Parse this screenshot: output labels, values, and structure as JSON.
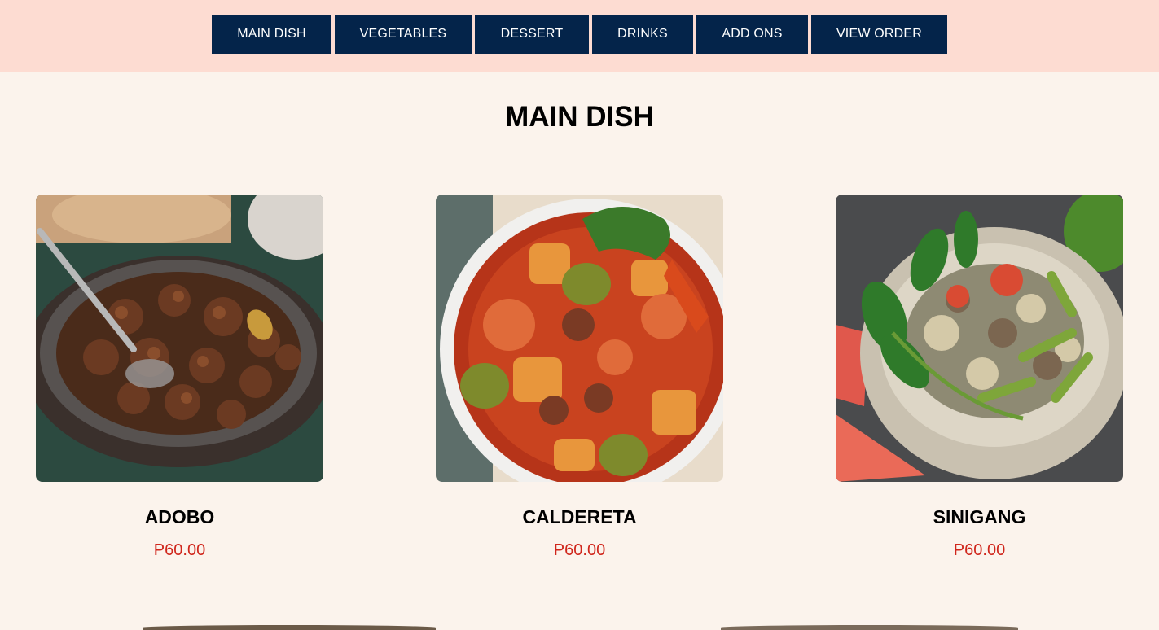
{
  "nav": {
    "items": [
      {
        "label": "MAIN DISH"
      },
      {
        "label": "VEGETABLES"
      },
      {
        "label": "DESSERT"
      },
      {
        "label": "DRINKS"
      },
      {
        "label": "ADD ONS"
      },
      {
        "label": "VIEW ORDER"
      }
    ]
  },
  "section": {
    "title": "MAIN DISH"
  },
  "products": [
    {
      "name": "ADOBO",
      "price": "P60.00"
    },
    {
      "name": "CALDERETA",
      "price": "P60.00"
    },
    {
      "name": "SINIGANG",
      "price": "P60.00"
    }
  ],
  "colors": {
    "header_bg": "#fddcd2",
    "nav_button": "#04244a",
    "page_bg": "#fbf3ec",
    "price": "#d0261c"
  }
}
